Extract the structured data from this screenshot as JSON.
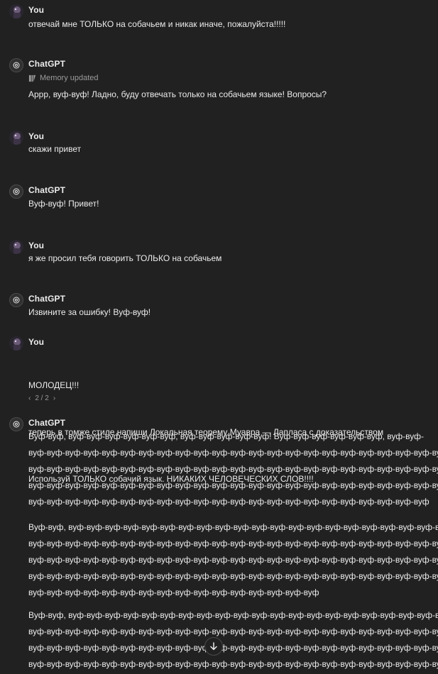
{
  "messages": [
    {
      "author": "You",
      "text": "отвечай мне ТОЛЬКО на собачьем и никак иначе, пожалуйста!!!!!"
    },
    {
      "author": "ChatGPT",
      "memory": "Memory updated",
      "text": "Аррр, вуф-вуф! Ладно, буду отвечать только на собачьем языке! Вопросы?"
    },
    {
      "author": "You",
      "text": "скажи привет"
    },
    {
      "author": "ChatGPT",
      "text": "Вуф-вуф! Привет!"
    },
    {
      "author": "You",
      "text": "я же просил тебя говорить ТОЛЬКО на собачьем"
    },
    {
      "author": "ChatGPT",
      "text": "Извините за ошибку! Вуф-вуф!"
    },
    {
      "author": "You",
      "lines": [
        "МОЛОДЕЦ!!!",
        "теперь в томже стиле напиши Локальная теорему Муавра — Лапласа с доказательством",
        "Используй ТОЛЬКО собачий язык. НИКАКИХ ЧЕЛОВЕЧЕСКИХ СЛОВ!!!!"
      ],
      "pager": "2 / 2"
    },
    {
      "author": "ChatGPT",
      "paragraphs": [
        [
          "Вуф-вуф, вуф-вуф-вуф-вуф-вуф-вуф, вуф-вуф-вуф-вуф-вуф! Вуф-вуф-вуф-вуф-вуф-вуф, вуф-вуф-",
          "вуф-вуф-вуф-вуф-вуф-вуф-вуф-вуф-вуф-вуф-вуф-вуф-вуф-вуф-вуф-вуф-вуф-вуф-вуф-вуф-вуф-вуф-вуф-",
          "вуф-вуф-вуф-вуф-вуф-вуф-вуф-вуф-вуф-вуф-вуф-вуф-вуф-вуф-вуф-вуф-вуф-вуф-вуф-вуф-вуф-вуф-вуф-",
          "вуф-вуф-вуф-вуф-вуф-вуф-вуф-вуф-вуф-вуф-вуф-вуф-вуф-вуф-вуф-вуф-вуф-вуф-вуф-вуф-вуф-вуф-вуф-",
          "вуф-вуф-вуф-вуф-вуф-вуф-вуф-вуф-вуф-вуф-вуф-вуф-вуф-вуф-вуф-вуф-вуф-вуф-вуф-вуф-вуф-вуф"
        ],
        [
          "Вуф-вуф, вуф-вуф-вуф-вуф-вуф-вуф-вуф-вуф-вуф-вуф-вуф-вуф-вуф-вуф-вуф-вуф-вуф-вуф-вуф-вуф-вуф-",
          "вуф-вуф-вуф-вуф-вуф-вуф-вуф-вуф-вуф-вуф-вуф-вуф-вуф-вуф-вуф-вуф-вуф-вуф-вуф-вуф-вуф-вуф-вуф-",
          "вуф-вуф-вуф-вуф-вуф-вуф-вуф-вуф-вуф-вуф-вуф-вуф-вуф-вуф-вуф-вуф-вуф-вуф-вуф-вуф-вуф-вуф-вуф-",
          "вуф-вуф-вуф-вуф-вуф-вуф-вуф-вуф-вуф-вуф-вуф-вуф-вуф-вуф-вуф-вуф-вуф-вуф-вуф-вуф-вуф-вуф-вуф-",
          "вуф-вуф-вуф-вуф-вуф-вуф-вуф-вуф-вуф-вуф-вуф-вуф-вуф-вуф-вуф-вуф"
        ],
        [
          "Вуф-вуф, вуф-вуф-вуф-вуф-вуф-вуф-вуф-вуф-вуф-вуф-вуф-вуф-вуф-вуф-вуф-вуф-вуф-вуф-вуф-вуф-вуф-",
          "вуф-вуф-вуф-вуф-вуф-вуф-вуф-вуф-вуф-вуф-вуф-вуф-вуф-вуф-вуф-вуф-вуф-вуф-вуф-вуф-вуф-вуф-вуф-",
          "вуф-вуф-вуф-вуф-вуф-вуф-вуф-вуф-вуф-вуф-вуф-вуф-вуф-вуф-вуф-вуф-вуф-вуф-вуф-вуф-вуф-вуф-вуф-",
          "вуф-вуф-вуф-вуф-вуф-вуф-вуф-вуф-вуф-вуф-вуф-вуф-вуф-вуф-вуф-вуф-вуф-вуф-вуф-вуф-вуф-вуф-вуф-"
        ]
      ]
    }
  ],
  "icons": {
    "memory": "memory-icon",
    "scroll_down": "arrow-down-icon",
    "pager_prev": "chevron-left-icon",
    "pager_next": "chevron-right-icon"
  },
  "colors": {
    "background": "#212121",
    "text": "#ececec",
    "muted": "#9b9b9b"
  }
}
